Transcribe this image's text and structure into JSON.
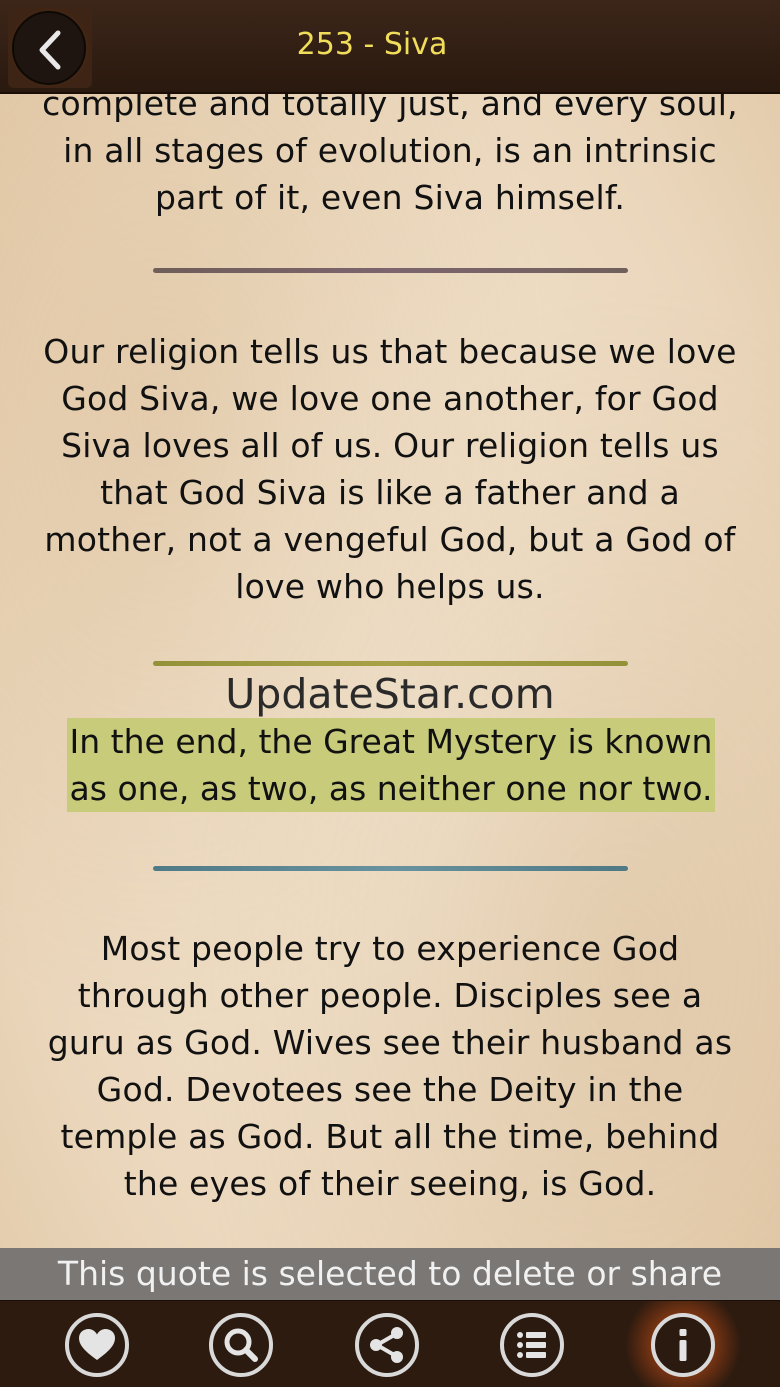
{
  "header": {
    "title": "253 - Siva",
    "back_icon": "chevron-left-icon"
  },
  "quotes": [
    {
      "text": "complete and totally just, and every soul, in all stages of evolution, is an intrinsic part of it, even Siva himself."
    },
    {
      "text": "Our religion tells us that because we love God Siva, we love one another, for God Siva loves all of us. Our religion tells us that God Siva is like a father and a mother, not a vengeful God, but a God of love who helps us."
    },
    {
      "text": "In the end, the Great Mystery is known as one, as two, as neither one nor two.",
      "selected": true
    },
    {
      "text": "Most people try to experience God through other people. Disciples see a guru as God. Wives see their husband as God. Devotees see the Deity in the temple as God. But all the time, behind the eyes of their seeing, is God."
    }
  ],
  "watermark": "UpdateStar.com",
  "status": "This quote is selected to delete or share",
  "toolbar": {
    "items": [
      {
        "icon": "heart-icon"
      },
      {
        "icon": "search-icon"
      },
      {
        "icon": "share-icon"
      },
      {
        "icon": "list-icon"
      },
      {
        "icon": "info-icon"
      }
    ]
  },
  "colors": {
    "header_bg": "#2a190f",
    "title": "#f0dd5a",
    "selection": "#c7cb7a",
    "status_bg": "#7a7775",
    "toolbar_bg": "#2e1b10"
  }
}
